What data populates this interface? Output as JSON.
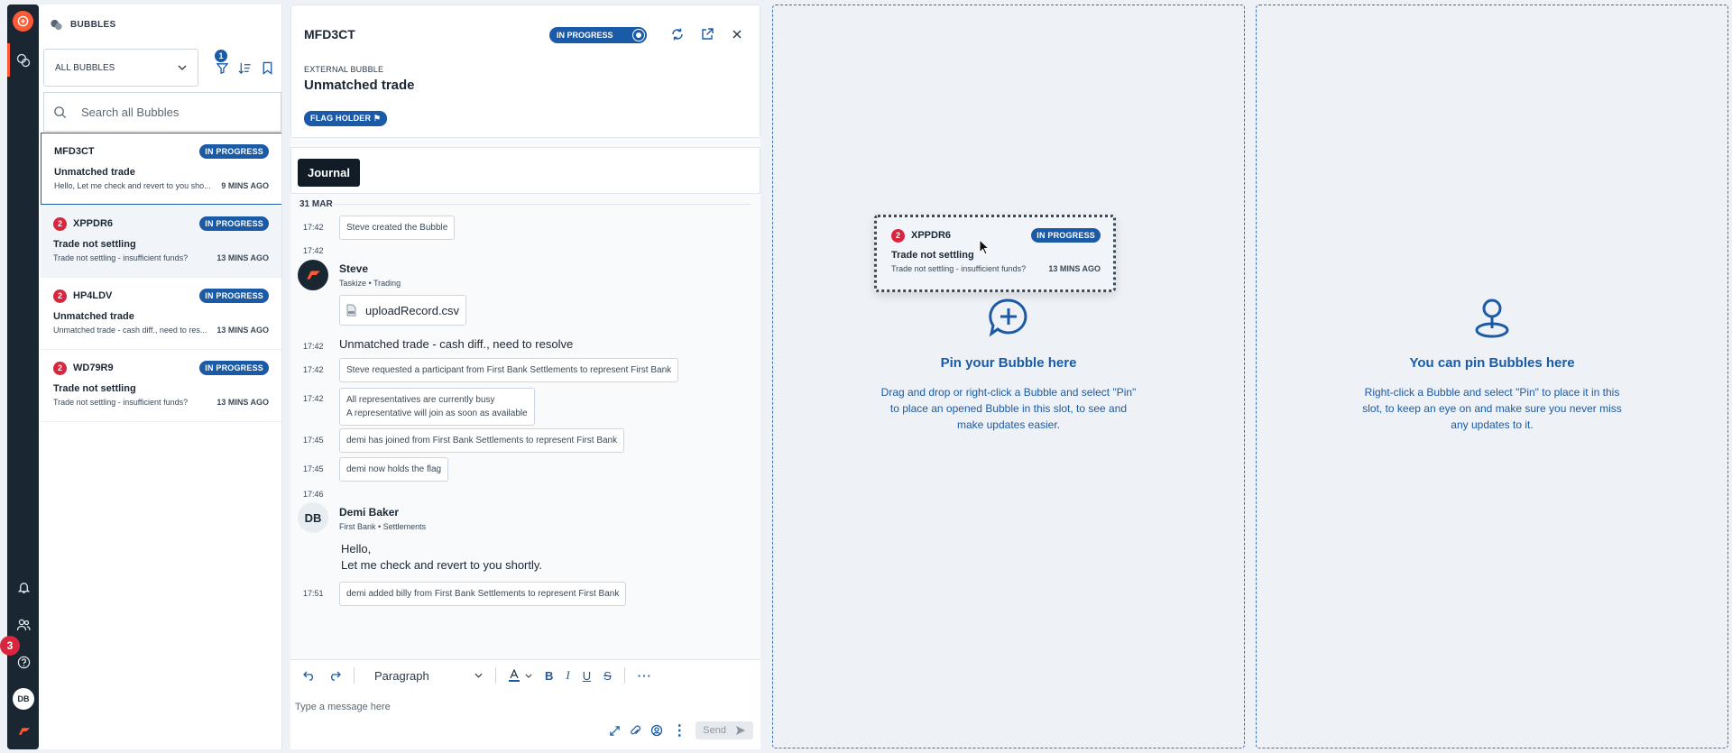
{
  "rail": {
    "notification_count": "3",
    "avatar_initials": "DB"
  },
  "list_panel": {
    "header": "BUBBLES",
    "filter_select": "ALL BUBBLES",
    "filter_badge": "1",
    "search_placeholder": "Search all Bubbles",
    "bubbles": [
      {
        "id": "MFD3CT",
        "status": "IN PROGRESS",
        "title": "Unmatched trade",
        "preview": "Hello, Let me check and revert to you sho...",
        "time": "9 MINS AGO",
        "unread": ""
      },
      {
        "id": "XPPDR6",
        "status": "IN PROGRESS",
        "title": "Trade not settling",
        "preview": "Trade not settling - insufficient funds?",
        "time": "13 MINS AGO",
        "unread": "2"
      },
      {
        "id": "HP4LDV",
        "status": "IN PROGRESS",
        "title": "Unmatched trade",
        "preview": "Unmatched trade - cash diff., need to res...",
        "time": "13 MINS AGO",
        "unread": "2"
      },
      {
        "id": "WD79R9",
        "status": "IN PROGRESS",
        "title": "Trade not settling",
        "preview": "Trade not settling - insufficient funds?",
        "time": "13 MINS AGO",
        "unread": "2"
      }
    ]
  },
  "detail": {
    "id": "MFD3CT",
    "status": "IN PROGRESS",
    "type": "EXTERNAL BUBBLE",
    "title": "Unmatched trade",
    "flag": "FLAG HOLDER",
    "tab": "Journal",
    "date": "31 MAR",
    "journal": {
      "t1": "17:42",
      "e1": "Steve created the Bubble",
      "t2": "17:42",
      "steve_name": "Steve",
      "steve_sub": "Taskize  •  Trading",
      "file": "uploadRecord.csv",
      "t3": "17:42",
      "msg1": "Unmatched trade - cash diff., need to resolve",
      "t4": "17:42",
      "e2": "Steve requested a participant from First Bank Settlements to represent First Bank",
      "t5": "17:42",
      "e3a": "All representatives are currently busy",
      "e3b": "A representative will join as soon as available",
      "t6": "17:45",
      "e4": "demi has joined from First Bank Settlements to represent First Bank",
      "t7": "17:45",
      "e5": "demi now holds the flag",
      "t8": "17:46",
      "demi_initials": "DB",
      "demi_name": "Demi Baker",
      "demi_sub": "First Bank  •  Settlements",
      "msg2a": "Hello,",
      "msg2b": "Let me check and revert to you shortly.",
      "t9": "17:51",
      "e6": "demi added billy from First Bank Settlements to represent First Bank"
    },
    "editor": {
      "format": "Paragraph",
      "placeholder": "Type a message here",
      "send": "Send"
    }
  },
  "slot1": {
    "title": "Pin your Bubble here",
    "text": "Drag and drop or right-click a Bubble and select \"Pin\" to place an opened Bubble in this slot, to see and make updates easier."
  },
  "slot2": {
    "title": "You can pin Bubbles here",
    "text": "Right-click a Bubble and select \"Pin\" to place it in this slot, to keep an eye on and make sure you never miss any updates to it."
  },
  "drag_card": {
    "id": "XPPDR6",
    "unread": "2",
    "status": "IN PROGRESS",
    "title": "Trade not settling",
    "preview": "Trade not settling - insufficient funds?",
    "time": "13 MINS AGO"
  },
  "colors": {
    "accent": "#1a5aa6",
    "brand": "#ff5a36",
    "rail": "#1a2733",
    "alert": "#d7263d"
  }
}
